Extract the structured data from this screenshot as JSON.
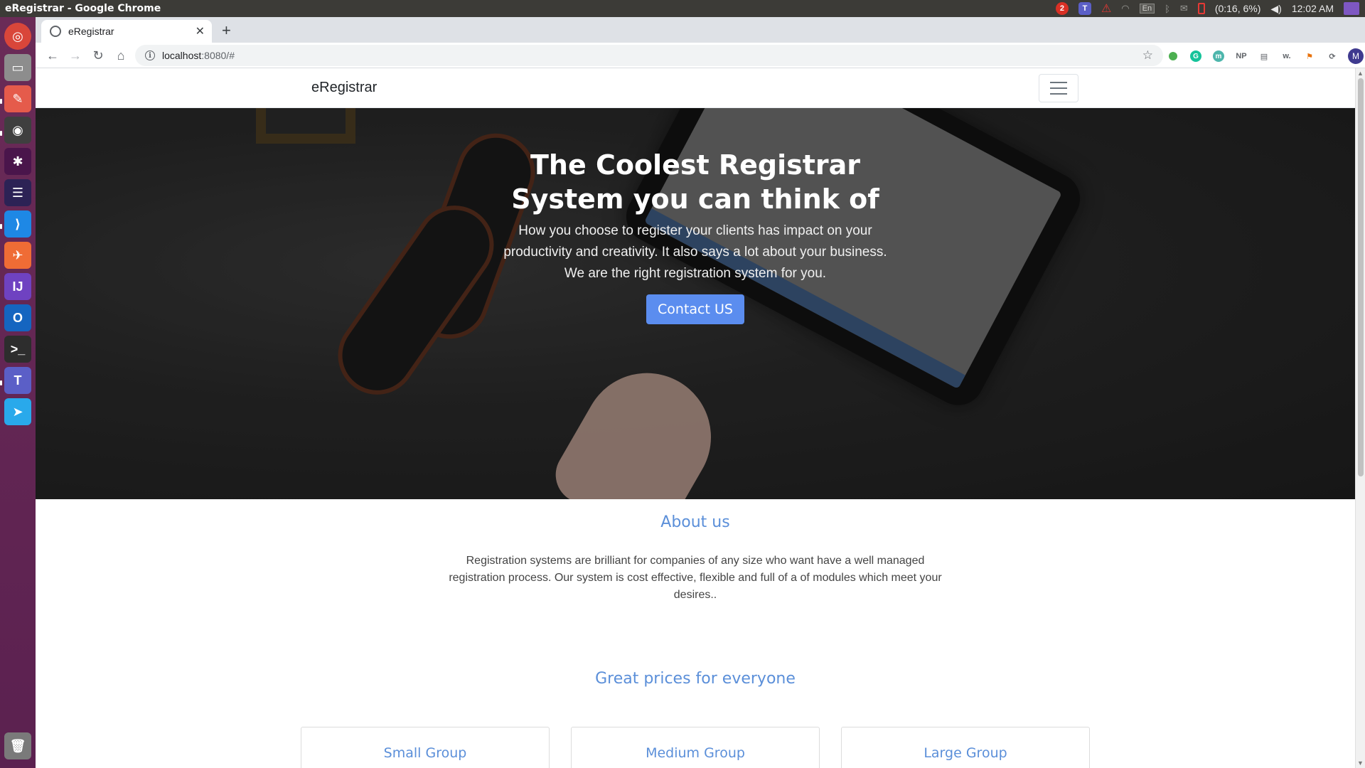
{
  "os": {
    "window_title": "eRegistrar - Google Chrome",
    "tray": {
      "notification_count": "2",
      "teams_label": "T",
      "keyboard_layout": "En",
      "battery_text": "(0:16, 6%)",
      "clock": "12:02 AM"
    }
  },
  "launcher": {
    "items": [
      "ubuntu-dash",
      "file-manager",
      "document-viewer",
      "chrome",
      "slack",
      "eclipse",
      "vscode",
      "postman",
      "intellij",
      "outlook",
      "terminal",
      "teams",
      "telegram",
      "trash"
    ]
  },
  "browser": {
    "tab_title": "eRegistrar",
    "new_tab_symbol": "+",
    "url_host": "localhost",
    "url_rest": ":8080/#",
    "avatar_letter": "M",
    "extensions": [
      "green-dot",
      "grammarly",
      "m-ext",
      "NP",
      "slides",
      "w.",
      "tag",
      "sync"
    ]
  },
  "site": {
    "brand": "eRegistrar",
    "hero": {
      "title": "The Coolest Registrar System you can think of",
      "subtitle": "How you choose to register your clients has impact on your productivity and creativity. It also says a lot about your business. We are the right registration system for you.",
      "button": "Contact US"
    },
    "about": {
      "title": "About us",
      "text": "Registration systems are brilliant for companies of any size who want have a well managed registration process. Our system is cost effective, flexible and full of a of modules which meet your desires.."
    },
    "pricing": {
      "title": "Great prices for everyone",
      "plans": [
        "Small Group",
        "Medium Group",
        "Large Group"
      ]
    }
  },
  "colors": {
    "accent": "#5b8fd9",
    "button": "#5b8def",
    "launcher_bg": "#5e2750",
    "os_bar": "#3c3b37"
  }
}
